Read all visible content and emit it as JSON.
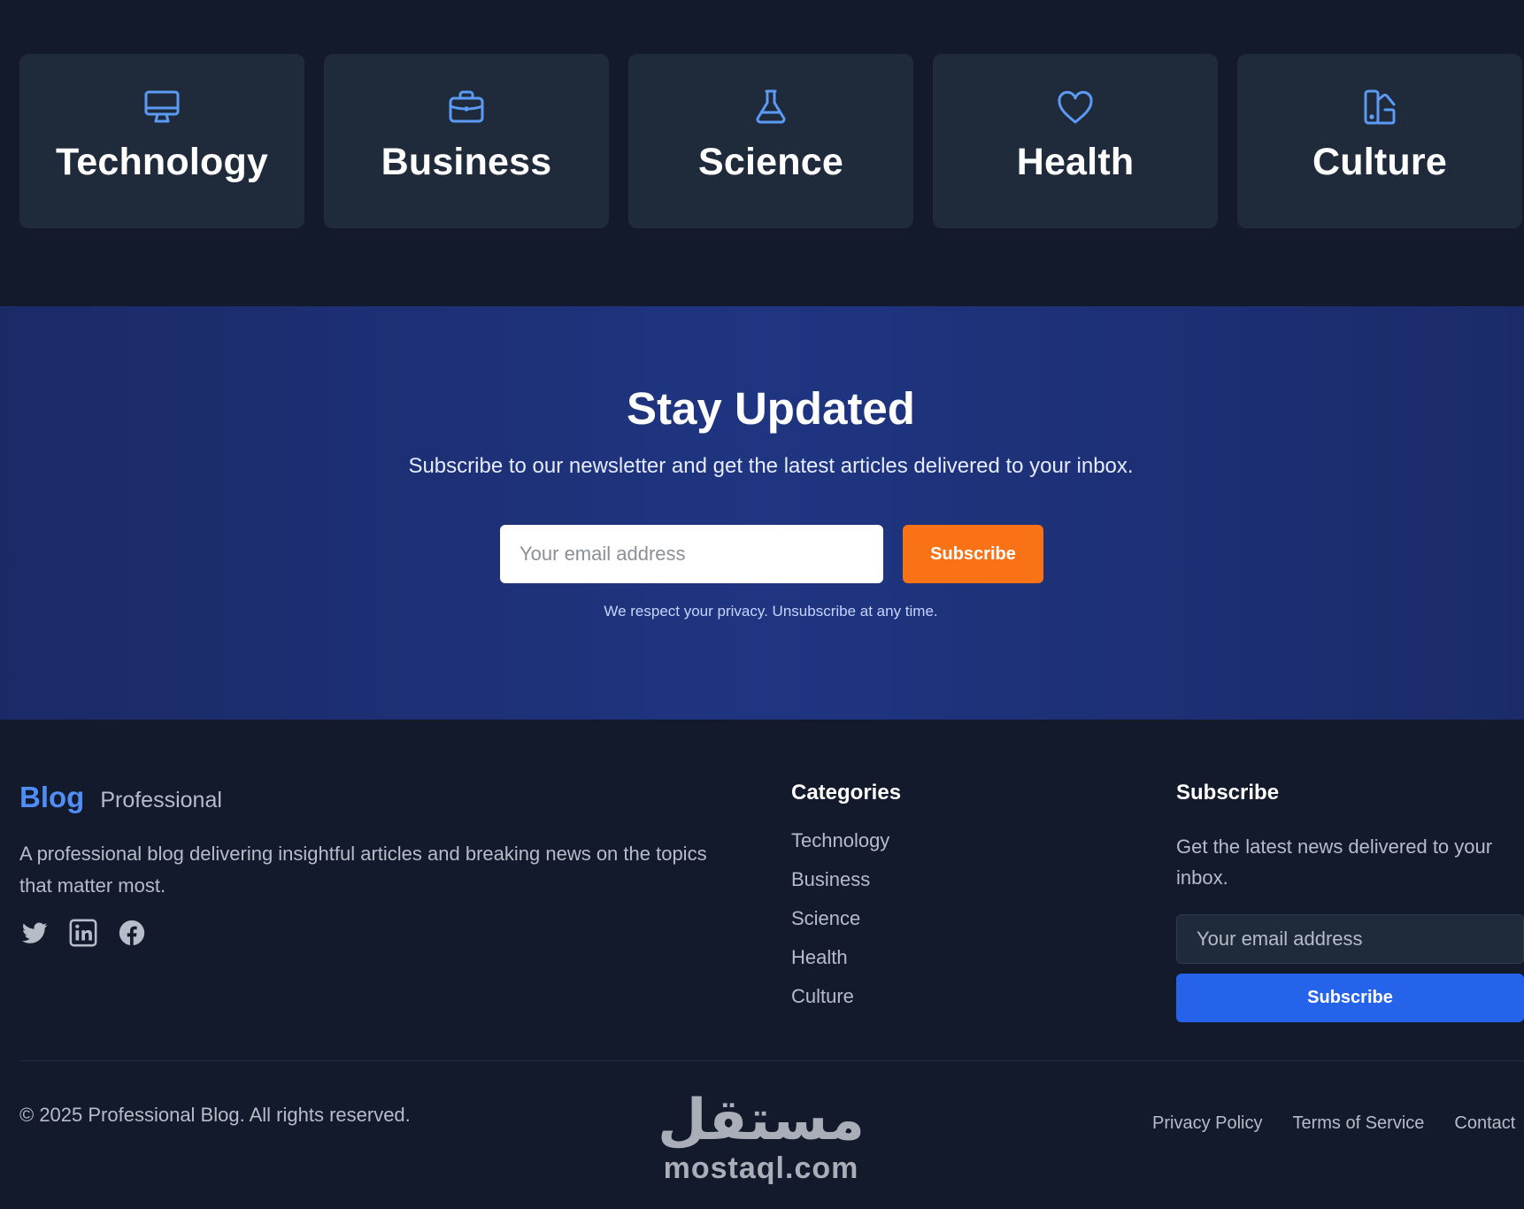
{
  "categories": [
    {
      "label": "Technology",
      "icon": "monitor-icon"
    },
    {
      "label": "Business",
      "icon": "briefcase-icon"
    },
    {
      "label": "Science",
      "icon": "flask-icon"
    },
    {
      "label": "Health",
      "icon": "heart-icon"
    },
    {
      "label": "Culture",
      "icon": "palette-icon"
    }
  ],
  "newsletter": {
    "title": "Stay Updated",
    "subtitle": "Subscribe to our newsletter and get the latest articles delivered to your inbox.",
    "email_placeholder": "Your email address",
    "button_label": "Subscribe",
    "privacy_note": "We respect your privacy. Unsubscribe at any time."
  },
  "footer": {
    "brand_name": "Blog",
    "brand_tagline": "Professional",
    "description": "A professional blog delivering insightful articles and breaking news on the topics that matter most.",
    "socials": [
      "twitter-icon",
      "linkedin-icon",
      "facebook-icon"
    ],
    "categories_title": "Categories",
    "category_links": [
      "Technology",
      "Business",
      "Science",
      "Health",
      "Culture"
    ],
    "subscribe_title": "Subscribe",
    "subscribe_desc": "Get the latest news delivered to your inbox.",
    "email_placeholder": "Your email address",
    "subscribe_button": "Subscribe",
    "copyright": "© 2025 Professional Blog. All rights reserved.",
    "legal_links": [
      "Privacy Policy",
      "Terms of Service",
      "Contact"
    ]
  },
  "watermark": {
    "arabic": "مستقل",
    "latin": "mostaql.com"
  },
  "colors": {
    "page_bg": "#121a2b",
    "card_bg": "#1f2a3b",
    "icon_blue": "#5b9bf5",
    "brand_blue": "#4f8ef7",
    "newsletter_bg": "#1f3581",
    "orange": "#f97316",
    "primary_blue": "#2563eb",
    "muted_text": "#b6bcc8"
  }
}
